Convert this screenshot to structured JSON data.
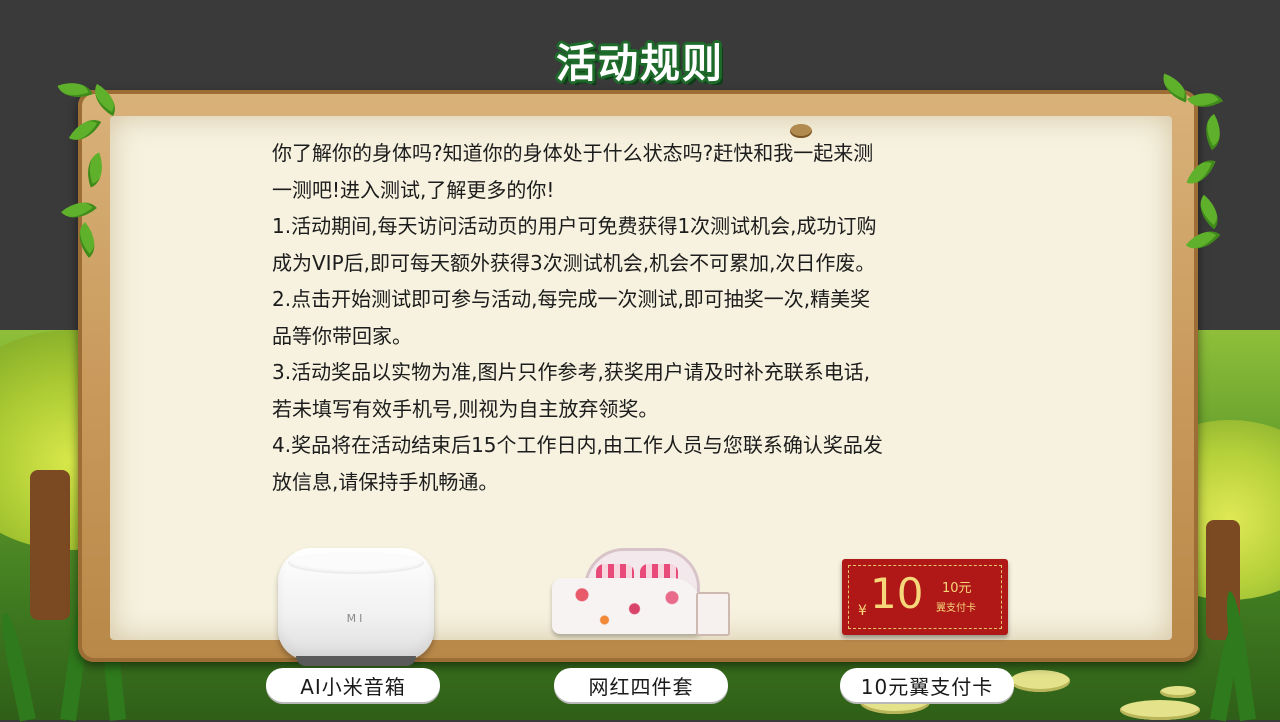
{
  "page": {
    "title": "活动规则"
  },
  "rules": {
    "lines": [
      "你了解你的身体吗?知道你的身体处于什么状态吗?赶快和我一起来测",
      "一测吧!进入测试,了解更多的你!",
      "1.活动期间,每天访问活动页的用户可免费获得1次测试机会,成功订购",
      "成为VIP后,即可每天额外获得3次测试机会,机会不可累加,次日作废。",
      "2.点击开始测试即可参与活动,每完成一次测试,即可抽奖一次,精美奖",
      "品等你带回家。",
      "3.活动奖品以实物为准,图片只作参考,获奖用户请及时补充联系电话,",
      "若未填写有效手机号,则视为自主放弃领奖。",
      "4.奖品将在活动结束后15个工作日内,由工作人员与您联系确认奖品发",
      "放信息,请保持手机畅通。"
    ]
  },
  "prizes": {
    "speaker": {
      "label": "AI小米音箱",
      "logo_text": "MI"
    },
    "bedding": {
      "label": "网红四件套"
    },
    "card": {
      "label": "10元翼支付卡",
      "amount": "10",
      "currency": "¥",
      "sub_amount": "10元",
      "sub_name": "翼支付卡",
      "color": "#b01818"
    }
  },
  "colors": {
    "title_outline": "#1e6a2a",
    "board": "#c99a5c",
    "paper": "#f6f2df",
    "background": "#3a3a3a"
  }
}
